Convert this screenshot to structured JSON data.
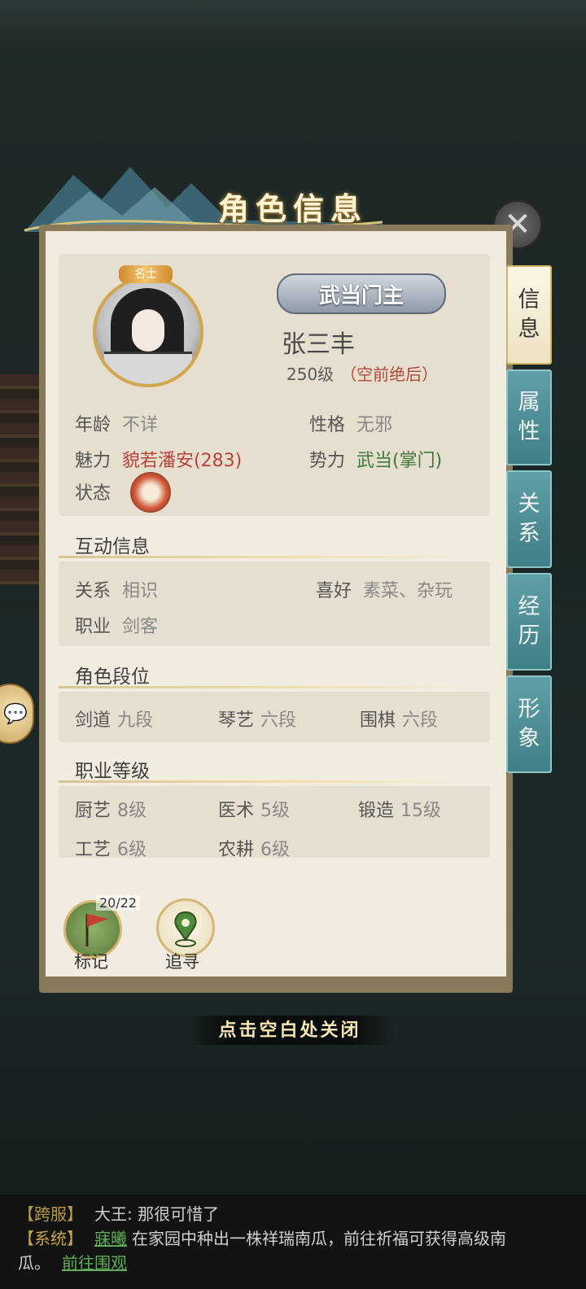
{
  "window": {
    "title": "角色信息",
    "close_label": "✕",
    "hint": "点击空白处关闭"
  },
  "avatar": {
    "badge": "名士"
  },
  "character": {
    "title_badge": "武当门主",
    "name": "张三丰",
    "level": "250级",
    "rank": "（空前绝后）"
  },
  "basic": {
    "age": {
      "label": "年龄",
      "value": "不详"
    },
    "personality": {
      "label": "性格",
      "value": "无邪"
    },
    "charm": {
      "label": "魅力",
      "value": "貌若潘安(283)"
    },
    "faction": {
      "label": "势力",
      "value": "武当(掌门)"
    },
    "status": {
      "label": "状态"
    }
  },
  "interaction": {
    "title": "互动信息",
    "relation": {
      "label": "关系",
      "value": "相识"
    },
    "hobby": {
      "label": "喜好",
      "value": "素菜、杂玩"
    },
    "job": {
      "label": "职业",
      "value": "剑客"
    }
  },
  "ranks": {
    "title": "角色段位",
    "items": [
      {
        "label": "剑道",
        "value": "九段"
      },
      {
        "label": "琴艺",
        "value": "六段"
      },
      {
        "label": "围棋",
        "value": "六段"
      }
    ]
  },
  "skills": {
    "title": "职业等级",
    "items": [
      {
        "label": "厨艺",
        "value": "8级"
      },
      {
        "label": "医术",
        "value": "5级"
      },
      {
        "label": "锻造",
        "value": "15级"
      },
      {
        "label": "工艺",
        "value": "6级"
      },
      {
        "label": "农耕",
        "value": "6级"
      }
    ]
  },
  "actions": {
    "mark": {
      "label": "标记",
      "count": "20/22"
    },
    "track": {
      "label": "追寻"
    }
  },
  "tabs": [
    {
      "label": "信\n息",
      "active": true
    },
    {
      "label": "属\n性"
    },
    {
      "label": "关\n系"
    },
    {
      "label": "经\n历"
    },
    {
      "label": "形\n象"
    }
  ],
  "chat": {
    "line1": {
      "tag": "【跨服】",
      "text": "大王: 那很可惜了"
    },
    "line2": {
      "tag": "【系统】",
      "user": "寐曦",
      "text": "在家园中种出一株祥瑞南瓜，前往祈福可获得高级南"
    },
    "line3": {
      "text": "瓜。",
      "link": "前往围观"
    }
  },
  "colors": {
    "accent_red": "#b8423a",
    "accent_green": "#3c7a3a",
    "tab_teal": "#4f8f97"
  }
}
